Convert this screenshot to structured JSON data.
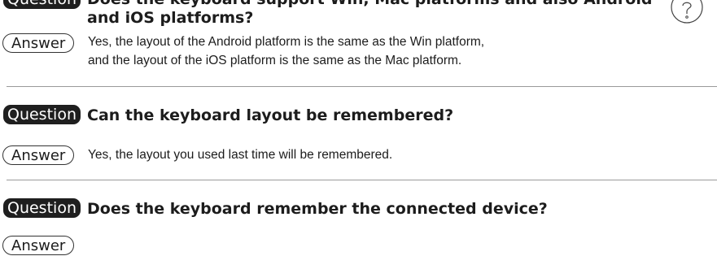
{
  "faq": [
    {
      "question_label": "Question",
      "question_line1": "Does the keyboard support Win, Mac platforms and also Android",
      "question_line2": "and iOS platforms?",
      "answer_label": "Answer",
      "answer_line1": "Yes, the layout of the Android platform is the same as the Win platform,",
      "answer_line2": "and the layout of the iOS platform is the same as the Mac platform."
    },
    {
      "question_label": "Question",
      "question": "Can the keyboard layout be remembered?",
      "answer_label": "Answer",
      "answer": "Yes, the layout you used last time will be remembered."
    },
    {
      "question_label": "Question",
      "question": "Does the keyboard remember the connected device?",
      "answer_label": "Answer"
    }
  ],
  "icons": {
    "help": "question-mark-circle-icon"
  }
}
